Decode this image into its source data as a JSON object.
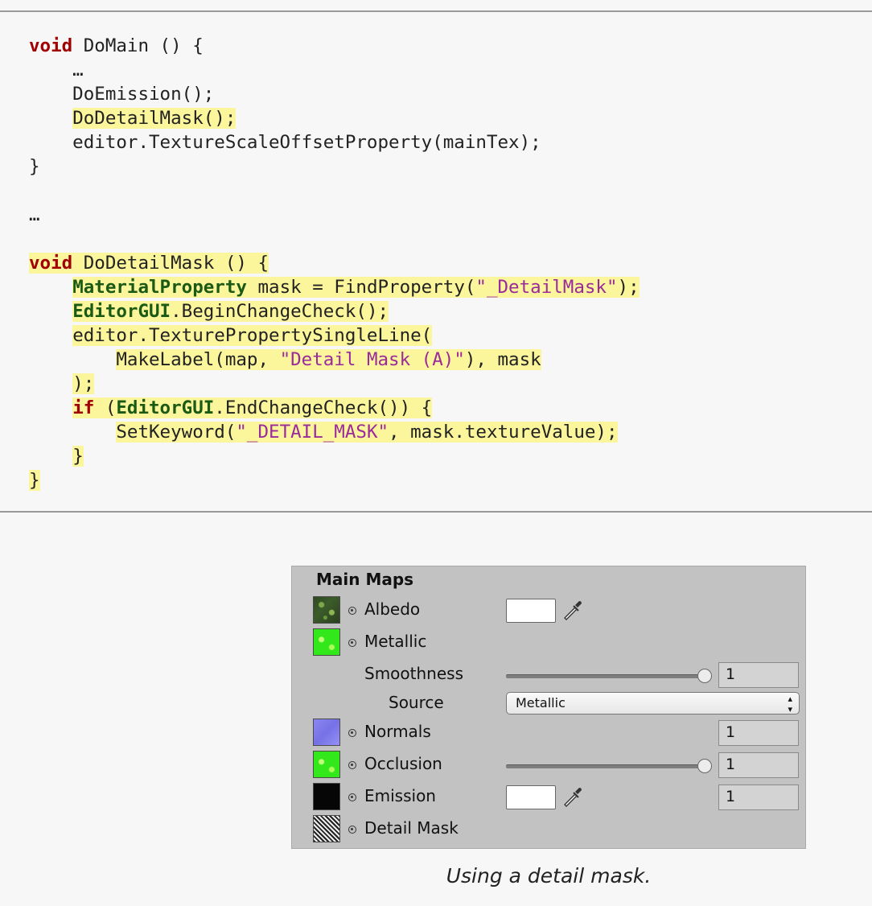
{
  "code": {
    "l1_kw": "void",
    "l1_rest": " DoMain () {",
    "l2": "    …",
    "l3": "    DoEmission();",
    "l4_indent": "    ",
    "l4_hl": "DoDetailMask();",
    "l5": "    editor.TextureScaleOffsetProperty(mainTex);",
    "l6": "}",
    "l8": "…",
    "l10_kw": "void",
    "l10_rest": " DoDetailMask () {",
    "l11_indent": "    ",
    "l11_type": "MaterialProperty",
    "l11_mid": " mask = FindProperty(",
    "l11_str": "\"_DetailMask\"",
    "l11_end": ");",
    "l12_indent": "    ",
    "l12_type": "EditorGUI",
    "l12_rest": ".BeginChangeCheck();",
    "l13_indent": "    ",
    "l13_rest": "editor.TexturePropertySingleLine(",
    "l14_indent": "        ",
    "l14_a": "MakeLabel(map, ",
    "l14_str": "\"Detail Mask (A)\"",
    "l14_b": "), mask",
    "l15_indent": "    ",
    "l15_rest": ");",
    "l16_indent": "    ",
    "l16_kw": "if",
    "l16_a": " (",
    "l16_type": "EditorGUI",
    "l16_b": ".EndChangeCheck()) {",
    "l17_indent": "        ",
    "l17_a": "SetKeyword(",
    "l17_str": "\"_DETAIL_MASK\"",
    "l17_b": ", mask.textureValue);",
    "l18_indent": "    ",
    "l18_rest": "}",
    "l19": "}"
  },
  "inspector": {
    "title": "Main Maps",
    "albedo": "Albedo",
    "metallic": "Metallic",
    "smoothness": "Smoothness",
    "smoothness_value": "1",
    "source": "Source",
    "source_selected": "Metallic",
    "normals": "Normals",
    "normals_value": "1",
    "occlusion": "Occlusion",
    "occlusion_value": "1",
    "emission": "Emission",
    "emission_value": "1",
    "detail_mask": "Detail Mask"
  },
  "caption": "Using a detail mask.",
  "colors": {
    "highlight": "#fbf59c",
    "keyword": "#a00000",
    "type": "#1a5a14",
    "string": "#9b2a9b",
    "panel_bg": "#c2c2c2"
  },
  "icons": [
    "eyedropper-icon",
    "texture-slot-icon",
    "dropdown-arrows-icon"
  ]
}
